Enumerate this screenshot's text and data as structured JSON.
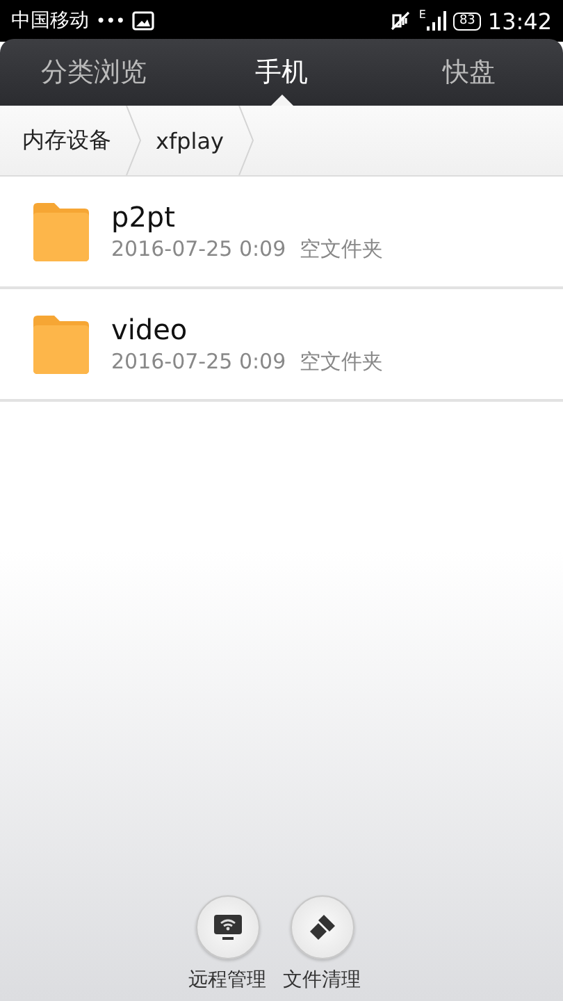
{
  "status_bar": {
    "carrier": "中国移动",
    "dots": "•••",
    "network": "E",
    "battery": "83",
    "time": "13:42"
  },
  "tabs": [
    {
      "label": "分类浏览",
      "selected": false
    },
    {
      "label": "手机",
      "selected": true
    },
    {
      "label": "快盘",
      "selected": false
    }
  ],
  "breadcrumb": [
    "内存设备",
    "xfplay"
  ],
  "files": [
    {
      "name": "p2pt",
      "date": "2016-07-25 0:09",
      "note": "空文件夹"
    },
    {
      "name": "video",
      "date": "2016-07-25 0:09",
      "note": "空文件夹"
    }
  ],
  "actions": [
    {
      "kind": "remote",
      "label": "远程管理"
    },
    {
      "kind": "clean",
      "label": "文件清理"
    }
  ]
}
